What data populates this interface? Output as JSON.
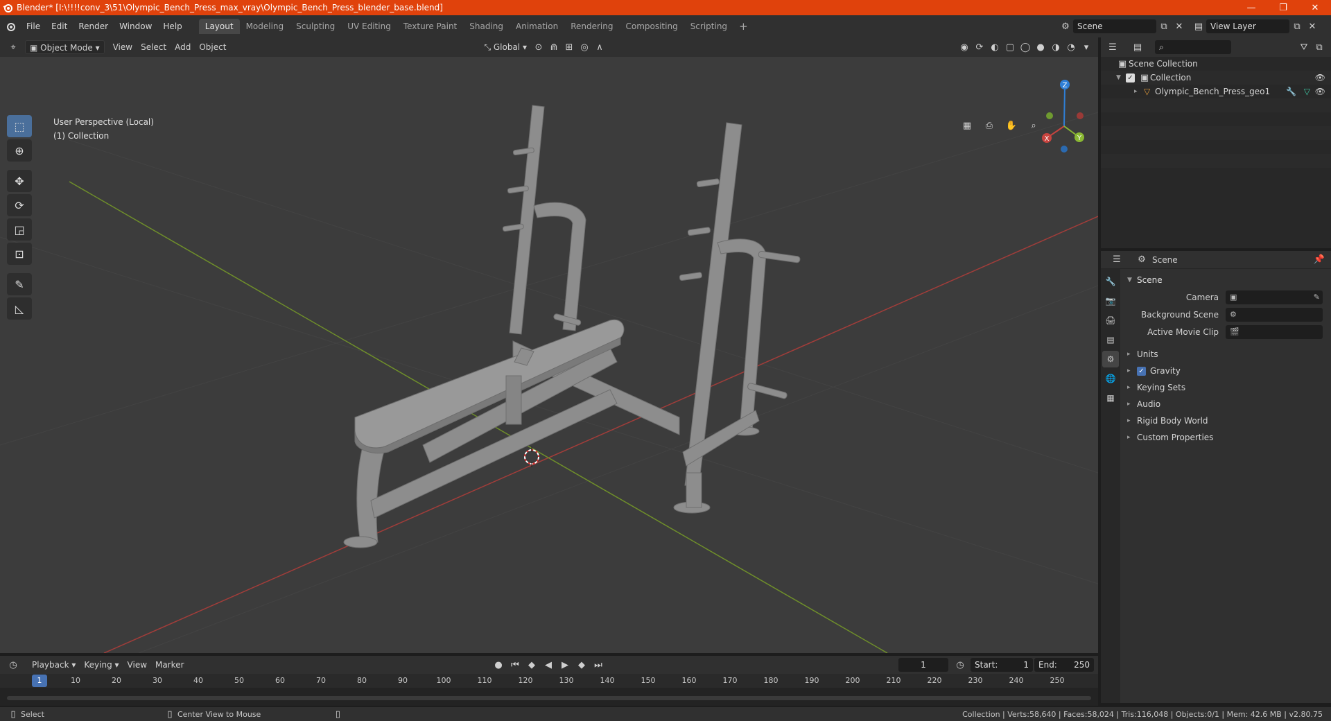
{
  "window": {
    "title": "Blender* [I:\\!!!!conv_3\\51\\Olympic_Bench_Press_max_vray\\Olympic_Bench_Press_blender_base.blend]",
    "minimize": "—",
    "maximize": "❐",
    "close": "✕"
  },
  "menu": {
    "items": [
      "File",
      "Edit",
      "Render",
      "Window",
      "Help"
    ],
    "workspaces": [
      "Layout",
      "Modeling",
      "Sculpting",
      "UV Editing",
      "Texture Paint",
      "Shading",
      "Animation",
      "Rendering",
      "Compositing",
      "Scripting"
    ],
    "active_workspace": "Layout",
    "add_workspace": "+",
    "scene_name": "Scene",
    "view_layer": "View Layer"
  },
  "viewport_header": {
    "mode": "Object Mode",
    "menus": [
      "View",
      "Select",
      "Add",
      "Object"
    ],
    "orientation": "Global"
  },
  "viewport": {
    "perspective_label": "User Perspective (Local)",
    "collection_label": "(1) Collection",
    "gizmo_axes": [
      "X",
      "Y",
      "Z"
    ],
    "colors": {
      "x_axis": "#c8443f",
      "y_axis": "#8ab833",
      "z_axis": "#2f7fd6",
      "bg": "#3c3c3c",
      "model": "#8d8d8d"
    }
  },
  "outliner": {
    "root": "Scene Collection",
    "collection": "Collection",
    "object": "Olympic_Bench_Press_geo1"
  },
  "properties": {
    "context": "Scene",
    "panel": "Scene",
    "rows": [
      {
        "label": "Camera"
      },
      {
        "label": "Background Scene"
      },
      {
        "label": "Active Movie Clip"
      }
    ],
    "subpanels": [
      "Units",
      "Gravity",
      "Keying Sets",
      "Audio",
      "Rigid Body World",
      "Custom Properties"
    ]
  },
  "timeline": {
    "menus": [
      "Playback",
      "Keying",
      "View",
      "Marker"
    ],
    "current_frame": "1",
    "start_label": "Start:",
    "start": "1",
    "end_label": "End:",
    "end": "250",
    "ticks": [
      "10",
      "20",
      "30",
      "40",
      "50",
      "60",
      "70",
      "80",
      "90",
      "100",
      "110",
      "120",
      "130",
      "140",
      "150",
      "160",
      "170",
      "180",
      "190",
      "200",
      "210",
      "220",
      "230",
      "240",
      "250"
    ],
    "cursor_frame": "1"
  },
  "statusbar": {
    "left_action": "Select",
    "mid_action": "Center View to Mouse",
    "stats": "Collection | Verts:58,640 | Faces:58,024 | Tris:116,048 | Objects:0/1 | Mem: 42.6 MB | v2.80.75"
  }
}
